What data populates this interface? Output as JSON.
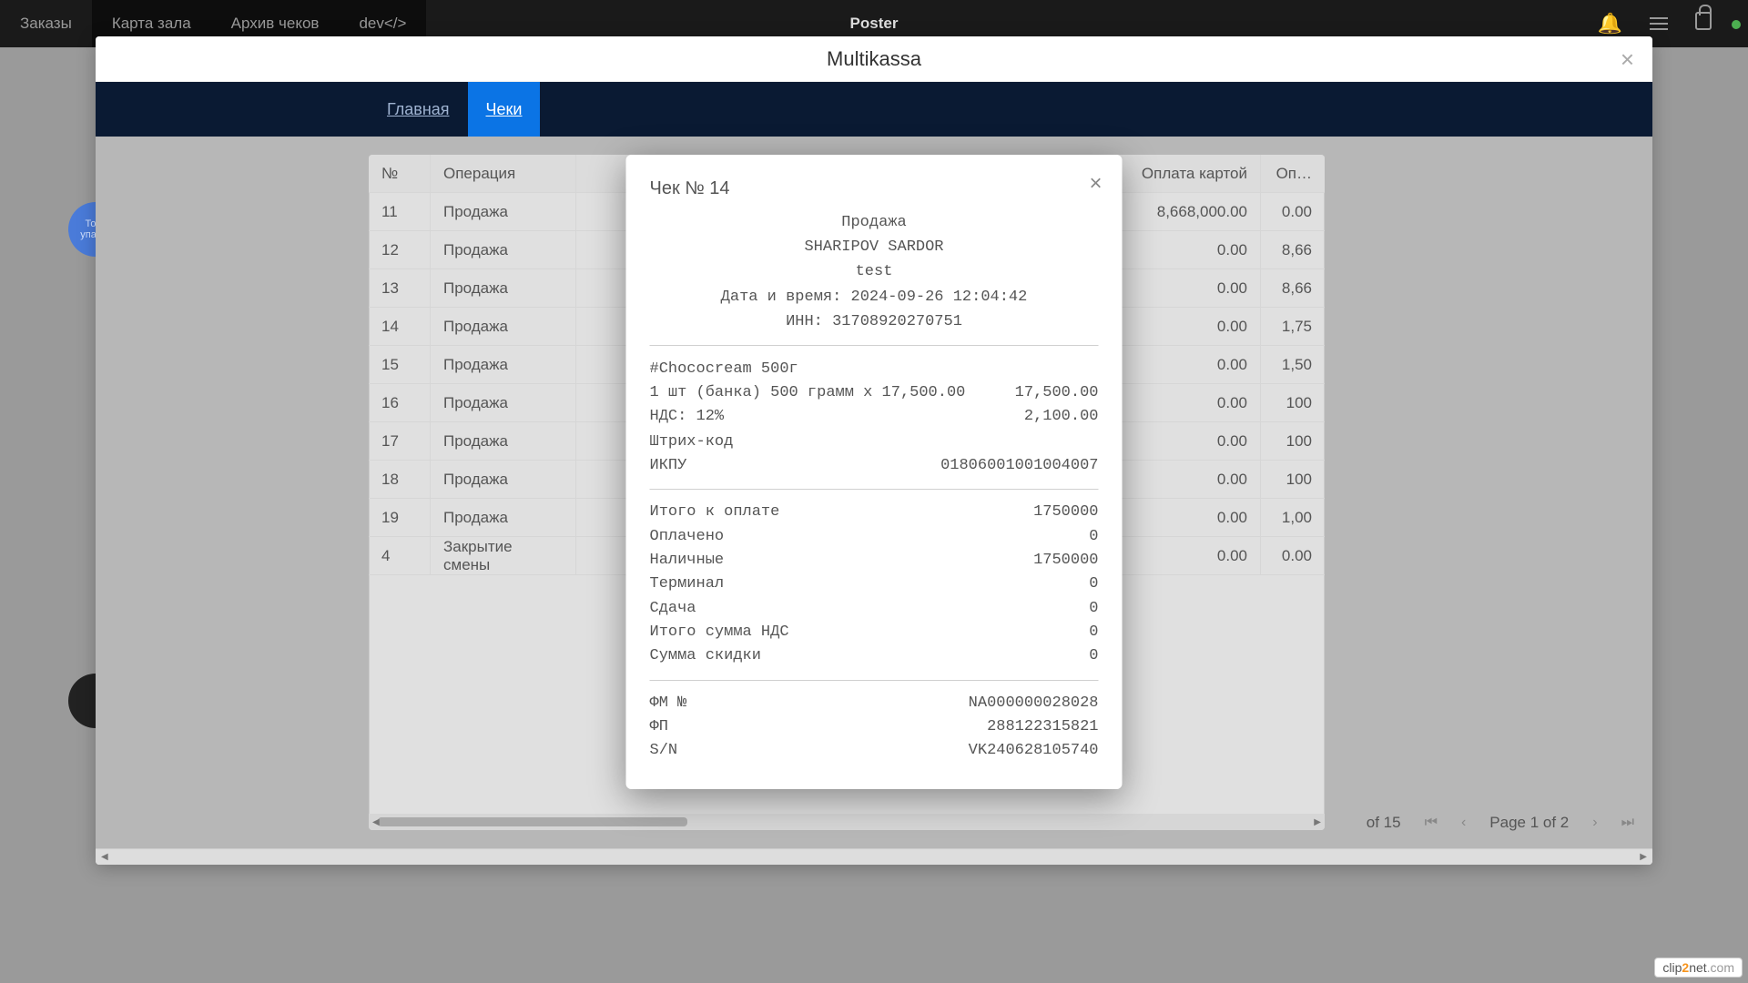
{
  "topnav": {
    "items": [
      "Заказы",
      "Карта зала",
      "Архив чеков",
      "dev</>"
    ],
    "brand": "Poster"
  },
  "avatar_blob_text": "Торт упак…",
  "modal": {
    "title": "Multikassa",
    "tabs": [
      "Главная",
      "Чеки"
    ],
    "active_tab": 1,
    "table": {
      "columns": {
        "num": "№",
        "op": "Операция",
        "card": "Оплата картой",
        "cash": "Оп…"
      },
      "rows": [
        {
          "num": "11",
          "op": "Продажа",
          "card": "8,668,000.00",
          "cash": "0.00"
        },
        {
          "num": "12",
          "op": "Продажа",
          "card": "0.00",
          "cash": "8,66"
        },
        {
          "num": "13",
          "op": "Продажа",
          "card": "0.00",
          "cash": "8,66"
        },
        {
          "num": "14",
          "op": "Продажа",
          "card": "0.00",
          "cash": "1,75"
        },
        {
          "num": "15",
          "op": "Продажа",
          "card": "0.00",
          "cash": "1,50"
        },
        {
          "num": "16",
          "op": "Продажа",
          "card": "0.00",
          "cash": "100"
        },
        {
          "num": "17",
          "op": "Продажа",
          "card": "0.00",
          "cash": "100"
        },
        {
          "num": "18",
          "op": "Продажа",
          "card": "0.00",
          "cash": "100"
        },
        {
          "num": "19",
          "op": "Продажа",
          "card": "0.00",
          "cash": "1,00"
        },
        {
          "num": "4",
          "op": "Закрытие смены",
          "card": "0.00",
          "cash": "0.00"
        }
      ]
    },
    "pager": {
      "range_suffix": "of 15",
      "page_label": "Page 1 of 2"
    }
  },
  "receipt": {
    "title": "Чек № 14",
    "header": {
      "type": "Продажа",
      "cashier": "SHARIPOV SARDOR",
      "shop": "test",
      "datetime_line": "Дата и время: 2024-09-26 12:04:42",
      "inn_line": "ИНН: 31708920270751"
    },
    "item": {
      "name": "#Chococream 500г",
      "line": "1 шт (банка) 500 грамм x 17,500.00",
      "line_total": "17,500.00",
      "vat_label": "НДС: 12%",
      "vat_amount": "2,100.00",
      "barcode_label": "Штрих-код",
      "ikpu_label": "ИКПУ",
      "ikpu": "01806001001004007"
    },
    "totals": [
      {
        "l": "Итого к оплате",
        "r": "1750000"
      },
      {
        "l": "Оплачено",
        "r": "0"
      },
      {
        "l": "Наличные",
        "r": "1750000"
      },
      {
        "l": "Терминал",
        "r": "0"
      },
      {
        "l": "Сдача",
        "r": "0"
      },
      {
        "l": "Итого сумма НДС",
        "r": "0"
      },
      {
        "l": "Сумма скидки",
        "r": "0"
      }
    ],
    "footer": [
      {
        "l": "ФМ №",
        "r": "NA000000028028"
      },
      {
        "l": "ФП",
        "r": "288122315821"
      },
      {
        "l": "S/N",
        "r": "VK240628105740"
      }
    ]
  },
  "watermark": {
    "pre": "clip",
    "orange": "2",
    "post": "net",
    "suffix": ".com"
  }
}
